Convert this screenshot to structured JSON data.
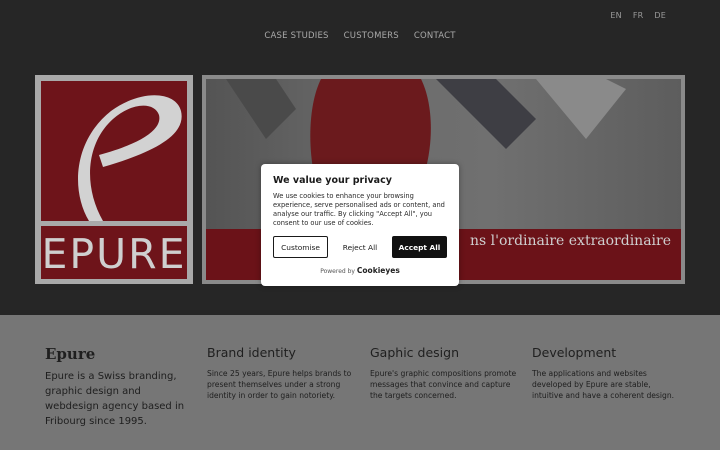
{
  "lang": [
    "EN",
    "FR",
    "DE"
  ],
  "nav": [
    "CASE STUDIES",
    "CUSTOMERS",
    "CONTACT"
  ],
  "logo": {
    "word": "EPURE"
  },
  "hero": {
    "tagline": "ns l'ordinaire extraordinaire"
  },
  "cols": [
    {
      "title": "Epure",
      "text": "Epure is a Swiss branding, graphic design and webdesign agency based in Fribourg since 1995."
    },
    {
      "title": "Brand identity",
      "text": "Since 25 years, Epure helps brands to present themselves under a strong identity in order to gain notoriety."
    },
    {
      "title": "Gaphic design",
      "text": "Epure's graphic compositions promote messages that convince and capture the targets concerned."
    },
    {
      "title": "Development",
      "text": "The applications and websites developed by Epure are stable, intuitive and have a coherent design."
    }
  ],
  "cookie": {
    "title": "We value your privacy",
    "message": "We use cookies to enhance your browsing experience, serve personalised ads or content, and analyse our traffic. By clicking \"Accept All\", you consent to our use of cookies.",
    "customise": "Customise",
    "reject": "Reject All",
    "accept": "Accept All",
    "powered_by": "Powered by",
    "brand": "Cookieyes"
  },
  "colors": {
    "brand_red": "#6e141a",
    "dark_bg": "#262626",
    "light_bg": "#767676"
  }
}
